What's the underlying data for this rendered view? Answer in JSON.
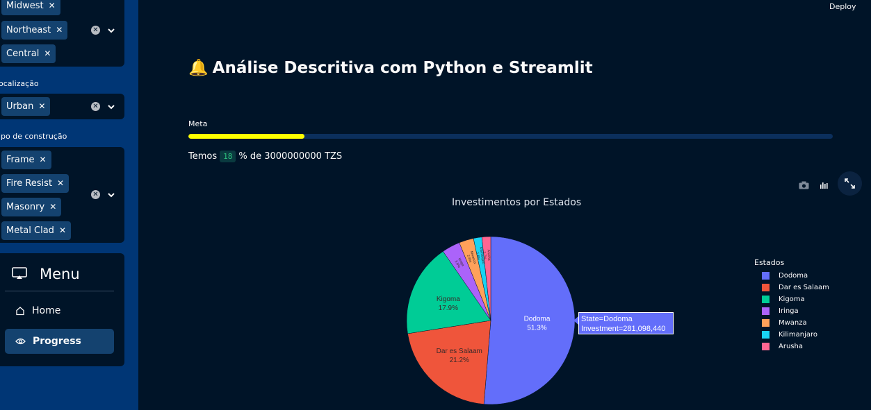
{
  "sidebar": {
    "region_filter": {
      "tags": [
        "Midwest",
        "Northeast",
        "Central"
      ]
    },
    "location_filter": {
      "label": "ocalização",
      "tags": [
        "Urban"
      ]
    },
    "construction_filter": {
      "label": "ipo de construção",
      "tags": [
        "Frame",
        "Fire Resist",
        "Masonry",
        "Metal Clad"
      ]
    },
    "menu": {
      "title": "Menu",
      "items": [
        {
          "label": "Home",
          "icon": "house-icon",
          "active": false
        },
        {
          "label": "Progress",
          "icon": "eye-icon",
          "active": true
        }
      ]
    }
  },
  "header": {
    "deploy_label": "Deploy"
  },
  "main": {
    "title_icon": "🔔",
    "title": "Análise Descritiva com Python e Streamlit",
    "meta_label": "Meta",
    "progress_percent": 18,
    "temos_prefix": "Temos",
    "temos_value": "18",
    "temos_suffix": "% de 3000000000 TZS"
  },
  "chart_data": {
    "type": "pie",
    "title": "Investimentos por Estados",
    "legend_title": "Estados",
    "legend_position": "right",
    "categories": [
      "Dodoma",
      "Dar es Salaam",
      "Kigoma",
      "Iringa",
      "Mwanza",
      "Kilimanjaro",
      "Arusha"
    ],
    "values": [
      51.3,
      21.2,
      17.9,
      3.5,
      2.8,
      1.6,
      1.7
    ],
    "value_unit": "%",
    "colors": [
      "#636efa",
      "#ef553b",
      "#00cc96",
      "#ab63fa",
      "#ffa15a",
      "#19d3f3",
      "#ff6692"
    ],
    "slice_labels": [
      {
        "name": "Dodoma",
        "pct": "51.3%"
      },
      {
        "name": "Dar es Salaam",
        "pct": "21.2%"
      },
      {
        "name": "Kigoma",
        "pct": "17.9%"
      },
      {
        "name": "Iringa",
        "pct": "3.5%"
      },
      {
        "name": "Mwanza",
        "pct": "2.8%"
      },
      {
        "name": "Kilimanjaro",
        "pct": "1.6%"
      },
      {
        "name": "Arusha",
        "pct": "1.7%"
      }
    ],
    "hover": {
      "line1": "State=Dodoma",
      "line2": "Investment=281,098,440"
    }
  }
}
